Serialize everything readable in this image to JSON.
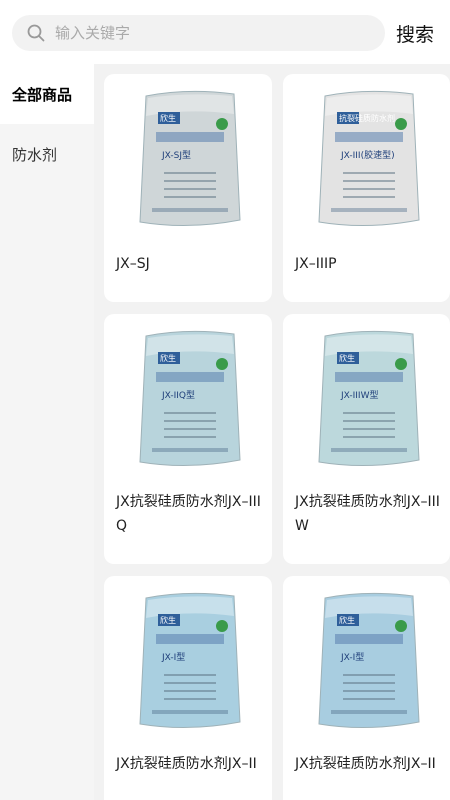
{
  "search": {
    "placeholder": "输入关键字",
    "button_label": "搜索"
  },
  "sidebar": {
    "items": [
      {
        "label": "全部商品"
      },
      {
        "label": "防水剂"
      }
    ]
  },
  "products": [
    {
      "title": "JX–SJ",
      "bag": "#cfd6d8",
      "brand": "欣生",
      "print": "JX-SJ型"
    },
    {
      "title": "JX–IIIP",
      "bag": "#e3e3e3",
      "brand": "抗裂硅质防水剂",
      "print": "JX-III(胶速型)"
    },
    {
      "title": "JX抗裂硅质防水剂JX–IIIQ",
      "bag": "#b8d4dc",
      "brand": "欣生",
      "print": "JX-IIQ型"
    },
    {
      "title": "JX抗裂硅质防水剂JX–IIIW",
      "bag": "#bcd8dc",
      "brand": "欣生",
      "print": "JX-IIIW型"
    },
    {
      "title": "JX抗裂硅质防水剂JX–II",
      "bag": "#a9cfe0",
      "brand": "欣生",
      "print": "JX-I型"
    },
    {
      "title": "JX抗裂硅质防水剂JX–II",
      "bag": "#a8cde0",
      "brand": "欣生",
      "print": "JX-I型"
    }
  ]
}
